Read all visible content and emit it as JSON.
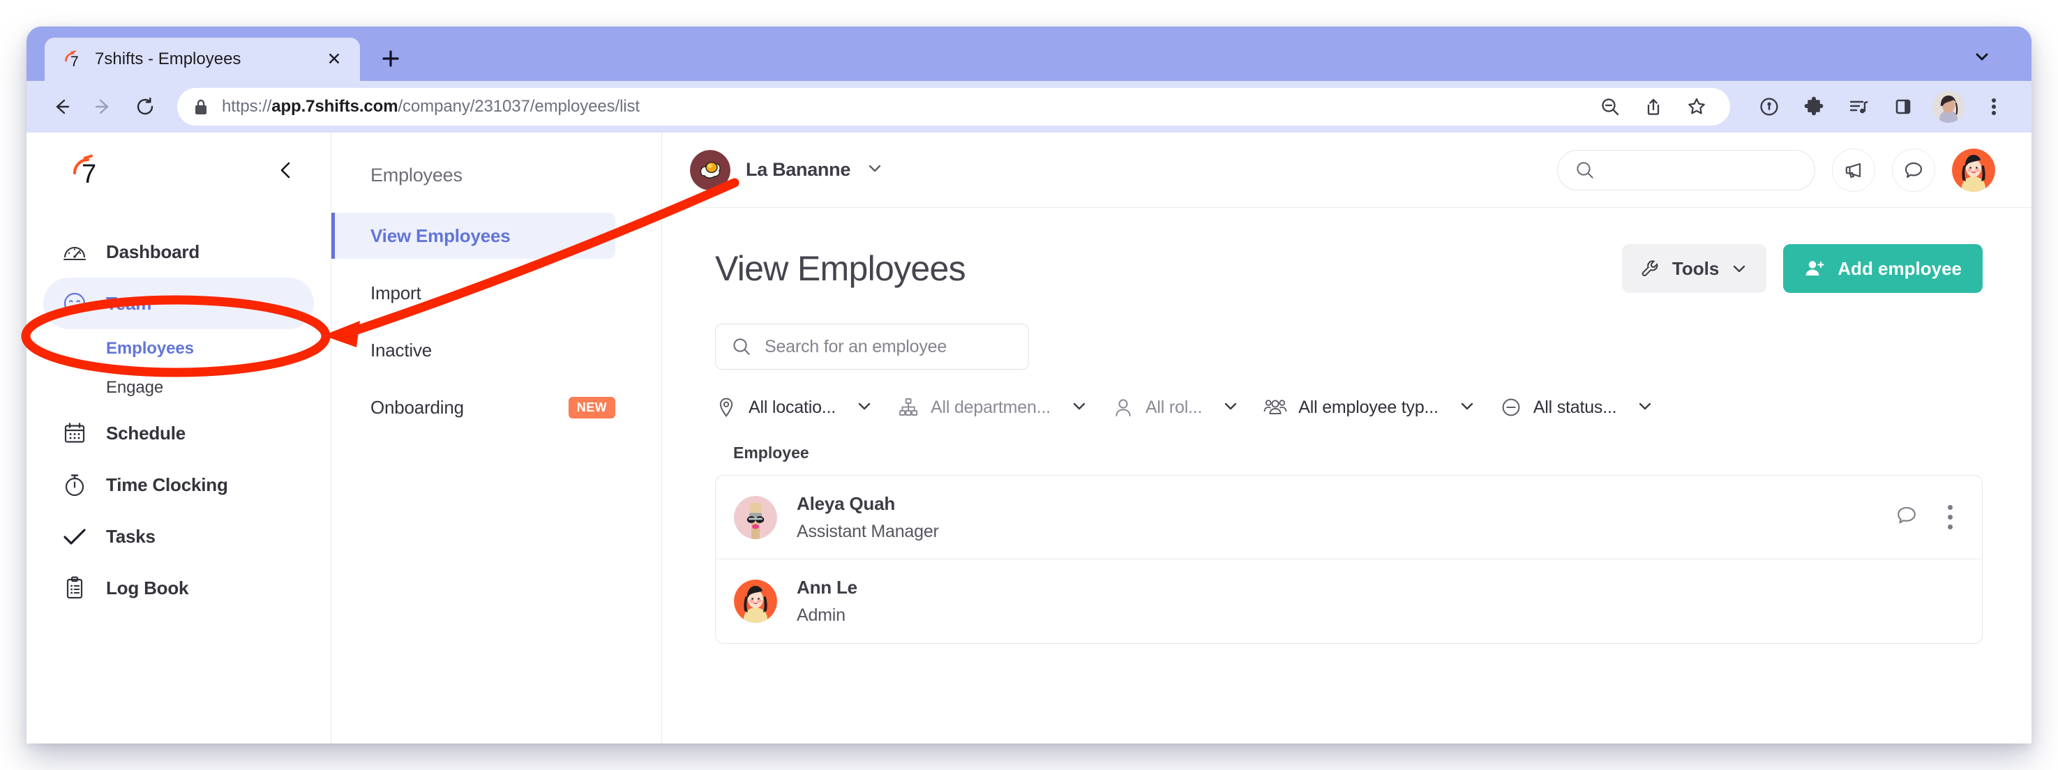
{
  "browser": {
    "tab_title": "7shifts - Employees",
    "url_prefix": "https://",
    "url_host": "app.7shifts.com",
    "url_path": "/company/231037/employees/list",
    "full_url": "https://app.7shifts.com/company/231037/employees/list"
  },
  "sidebar": {
    "items": [
      {
        "label": "Dashboard",
        "icon": "gauge-icon",
        "active": false
      },
      {
        "label": "Team",
        "icon": "smiley-icon",
        "active": true
      },
      {
        "label": "Schedule",
        "icon": "calendar-icon",
        "active": false
      },
      {
        "label": "Time Clocking",
        "icon": "stopwatch-icon",
        "active": false
      },
      {
        "label": "Tasks",
        "icon": "check-icon",
        "active": false
      },
      {
        "label": "Log Book",
        "icon": "clipboard-icon",
        "active": false
      }
    ],
    "sub_items": [
      {
        "label": "Employees",
        "active": true
      },
      {
        "label": "Engage",
        "active": false
      }
    ]
  },
  "subnav": {
    "title": "Employees",
    "items": [
      {
        "label": "View Employees",
        "active": true,
        "badge": ""
      },
      {
        "label": "Import",
        "active": false,
        "badge": ""
      },
      {
        "label": "Inactive",
        "active": false,
        "badge": ""
      },
      {
        "label": "Onboarding",
        "active": false,
        "badge": "NEW"
      }
    ]
  },
  "appbar": {
    "company_name": "La Bananne",
    "search_value": "",
    "search_placeholder": ""
  },
  "main": {
    "title": "View Employees",
    "tools_label": "Tools",
    "add_employee_label": "Add employee",
    "search_placeholder": "Search for an employee",
    "search_value": "",
    "filters": [
      {
        "label": "All locatio...",
        "icon": "location-pin-icon",
        "emphasis": "dark"
      },
      {
        "label": "All departmen...",
        "icon": "org-chart-icon",
        "emphasis": "muted"
      },
      {
        "label": "All rol...",
        "icon": "person-icon",
        "emphasis": "muted"
      },
      {
        "label": "All employee typ...",
        "icon": "people-group-icon",
        "emphasis": "dark"
      },
      {
        "label": "All status...",
        "icon": "minus-circle-icon",
        "emphasis": "dark"
      }
    ],
    "table": {
      "column_header": "Employee",
      "rows": [
        {
          "name": "Aleya Quah",
          "role": "Assistant Manager",
          "avatar_bg": "#f0cbce"
        },
        {
          "name": "Ann Le",
          "role": "Admin",
          "avatar_bg": "#fa5f32"
        }
      ]
    }
  },
  "colors": {
    "accent_teal": "#2ebba5",
    "accent_blue": "#6275d8",
    "badge_orange": "#fa7d54",
    "annotation_red": "#fa2600",
    "chrome_purple": "#9aa6ee",
    "tab_lavender": "#dbe0fb"
  }
}
